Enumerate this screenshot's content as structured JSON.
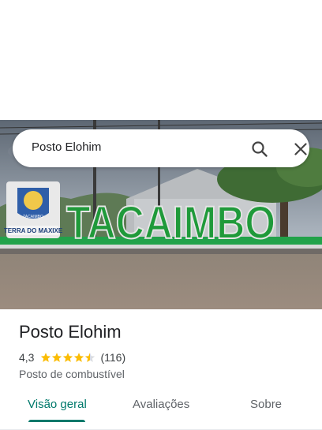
{
  "search": {
    "query": "Posto Elohim",
    "search_icon": "search-icon",
    "close_icon": "close-icon"
  },
  "photo": {
    "sign_text": "TACAIMBO",
    "crest_text": "TERRA DO MAXIXE",
    "crest_seal_text": "TACAIMBO"
  },
  "place": {
    "name": "Posto Elohim",
    "rating": "4,3",
    "rating_value": 4.3,
    "review_count": "(116)",
    "category": "Posto de combustível"
  },
  "tabs": [
    {
      "label": "Visão geral",
      "active": true
    },
    {
      "label": "Avaliações",
      "active": false
    },
    {
      "label": "Sobre",
      "active": false
    }
  ],
  "colors": {
    "accent": "#00796b",
    "star": "#fbbc04",
    "sign_green": "#1f9a3a"
  }
}
